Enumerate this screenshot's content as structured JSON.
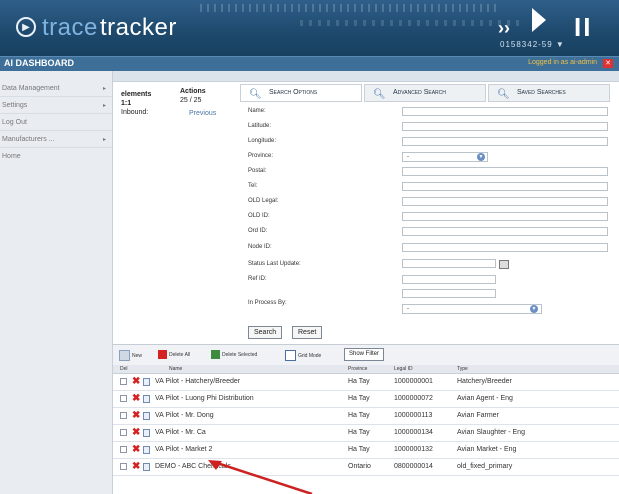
{
  "header": {
    "logo_trace": "trace",
    "logo_tracker": "tracker",
    "right_code": "0158342-59 ▼"
  },
  "tabbar": {
    "title": "AI DASHBOARD",
    "logout": "Logged in as ai-admin"
  },
  "sidebar": {
    "items": [
      {
        "label": "Data Management",
        "arrow": "▸"
      },
      {
        "label": "Settings",
        "arrow": "▸"
      },
      {
        "label": "Log Out",
        "arrow": ""
      },
      {
        "label": "Manufacturers ...",
        "arrow": "▸"
      },
      {
        "label": "Home",
        "arrow": ""
      }
    ]
  },
  "info": {
    "elements_label": "elements",
    "elements_ratio": "1:1",
    "inbound_label": "Inbound:",
    "actions_label": "Actions",
    "actions_count": "25 / 25",
    "previous_label": "Previous"
  },
  "search_tabs": [
    {
      "label": "Search Options"
    },
    {
      "label": "Advanced Search"
    },
    {
      "label": "Saved Searches"
    }
  ],
  "form_fields": [
    {
      "label": "Name:"
    },
    {
      "label": "Latitude:"
    },
    {
      "label": "Longitude:"
    },
    {
      "label": "Province:",
      "select": "-"
    },
    {
      "label": "Postal:"
    },
    {
      "label": "Tel:"
    },
    {
      "label": "OLD Legal:"
    },
    {
      "label": "OLD ID:"
    },
    {
      "label": "Ord ID:"
    },
    {
      "label": "Node ID:"
    },
    {
      "label": "Status Last Update:"
    },
    {
      "label": "Ref ID:"
    },
    {
      "label": ""
    },
    {
      "label": "In Process By:",
      "select": "-"
    }
  ],
  "buttons": {
    "search": "Search",
    "reset": "Reset"
  },
  "toolbar": {
    "new": "New",
    "delete_all": "Delete All",
    "delete_selected": "Delete Selected",
    "grid_mode": "Grid Mode",
    "show_filter": "Show Filter"
  },
  "table": {
    "headers": [
      "Del",
      "Name",
      "Province",
      "Legal ID",
      "Type"
    ],
    "rows": [
      {
        "name": "VA Pilot - Hatchery/Breeder",
        "province": "Ha Tay",
        "id": "1000000001",
        "type": "Hatchery/Breeder"
      },
      {
        "name": "VA Pilot - Luong Phi Distribution",
        "province": "Ha Tay",
        "id": "1000000072",
        "type": "Avian Agent - Eng"
      },
      {
        "name": "VA Pilot - Mr. Dong",
        "province": "Ha Tay",
        "id": "1000000113",
        "type": "Avian Farmer"
      },
      {
        "name": "VA Pilot - Mr. Ca",
        "province": "Ha Tay",
        "id": "1000000134",
        "type": "Avian Slaughter - Eng"
      },
      {
        "name": "VA Pilot - Market 2",
        "province": "Ha Tay",
        "id": "1000000132",
        "type": "Avian Market - Eng"
      },
      {
        "name": "DEMO - ABC Chemicals",
        "province": "Ontario",
        "id": "0800000014",
        "type": "old_fixed_primary"
      }
    ]
  },
  "colors": {
    "banner": "#1f4a6e",
    "tabbar": "#3d6f99",
    "delete": "#d42222",
    "annotation_arrow": "#cc2222"
  }
}
